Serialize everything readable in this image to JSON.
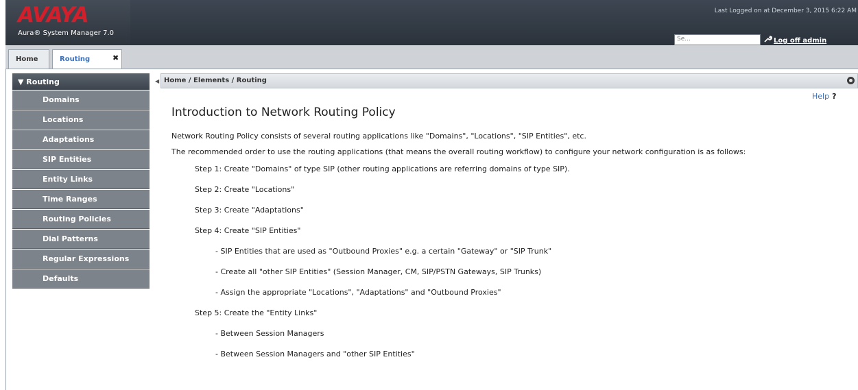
{
  "header": {
    "logo": "AVAYA",
    "product": "Aura® System Manager 7.0",
    "last_logged": "Last Logged on at December 3, 2015 6:22 AM",
    "search_placeholder": "Se...",
    "logoff": "Log off admin"
  },
  "tabs": [
    {
      "label": "Home"
    },
    {
      "label": "Routing"
    }
  ],
  "tab_close": "✖",
  "sidebar": {
    "header": "Routing",
    "items": [
      {
        "label": "Domains"
      },
      {
        "label": "Locations"
      },
      {
        "label": "Adaptations"
      },
      {
        "label": "SIP Entities"
      },
      {
        "label": "Entity Links"
      },
      {
        "label": "Time Ranges"
      },
      {
        "label": "Routing Policies"
      },
      {
        "label": "Dial Patterns"
      },
      {
        "label": "Regular Expressions"
      },
      {
        "label": "Defaults"
      }
    ]
  },
  "breadcrumb": "Home / Elements / Routing",
  "help": "Help",
  "help_mark": "?",
  "content": {
    "title": "Introduction to Network Routing Policy",
    "para1": "Network Routing Policy consists of several routing applications like \"Domains\", \"Locations\", \"SIP Entities\", etc.",
    "para2": "The recommended order to use the routing applications (that means the overall routing workflow) to configure your network configuration is as follows:",
    "step1": "Step 1: Create \"Domains\" of type SIP (other routing applications are referring domains of type SIP).",
    "step2": "Step 2: Create \"Locations\"",
    "step3": "Step 3: Create \"Adaptations\"",
    "step4": "Step 4: Create \"SIP Entities\"",
    "step4_sub1": "- SIP Entities that are used as \"Outbound Proxies\" e.g. a certain \"Gateway\" or \"SIP Trunk\"",
    "step4_sub2": "- Create all \"other SIP Entities\" (Session Manager, CM, SIP/PSTN Gateways, SIP Trunks)",
    "step4_sub3": "- Assign the appropriate \"Locations\", \"Adaptations\" and \"Outbound Proxies\"",
    "step5": "Step 5: Create the \"Entity Links\"",
    "step5_sub1": "- Between Session Managers",
    "step5_sub2": "- Between Session Managers and \"other SIP Entities\""
  }
}
